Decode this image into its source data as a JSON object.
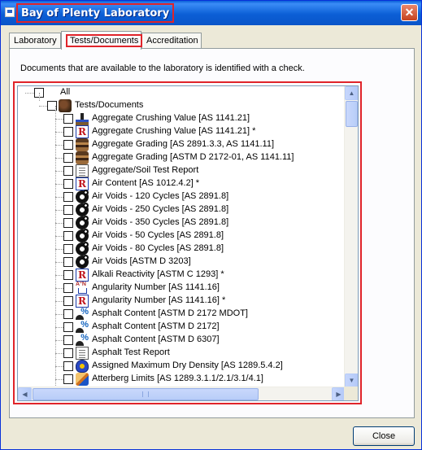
{
  "window": {
    "title": "Bay of Plenty Laboratory",
    "close_glyph": "✕"
  },
  "tabs": [
    {
      "label": "Laboratory",
      "active": false
    },
    {
      "label": "Tests/Documents",
      "active": true
    },
    {
      "label": "Accreditation",
      "active": false
    }
  ],
  "instruction": "Documents that are available to the laboratory is identified with a check.",
  "tree": {
    "root": {
      "label": "All",
      "checked": false
    },
    "group": {
      "label": "Tests/Documents",
      "checked": false,
      "icon": "folder-icon"
    },
    "items": [
      {
        "label": "Aggregate Crushing Value [AS 1141.21]",
        "icon": "crush",
        "checked": false
      },
      {
        "label": "Aggregate Crushing Value [AS 1141.21] *",
        "icon": "r",
        "checked": false
      },
      {
        "label": "Aggregate Grading [AS 2891.3.3, AS 1141.11]",
        "icon": "stack",
        "checked": false
      },
      {
        "label": "Aggregate Grading [ASTM D 2172-01, AS 1141.11]",
        "icon": "stack",
        "checked": false
      },
      {
        "label": "Aggregate/Soil Test Report",
        "icon": "doc",
        "checked": false
      },
      {
        "label": "Air Content [AS 1012.4.2] *",
        "icon": "r",
        "checked": false
      },
      {
        "label": "Air Voids - 120 Cycles [AS 2891.8]",
        "icon": "gear",
        "checked": false
      },
      {
        "label": "Air Voids - 250 Cycles [AS 2891.8]",
        "icon": "gear",
        "checked": false
      },
      {
        "label": "Air Voids - 350 Cycles [AS 2891.8]",
        "icon": "gear",
        "checked": false
      },
      {
        "label": "Air Voids - 50 Cycles [AS 2891.8]",
        "icon": "gear",
        "checked": false
      },
      {
        "label": "Air Voids - 80 Cycles [AS 2891.8]",
        "icon": "gear",
        "checked": false
      },
      {
        "label": "Air Voids [ASTM D 3203]",
        "icon": "gear",
        "checked": false
      },
      {
        "label": "Alkali Reactivity [ASTM C 1293] *",
        "icon": "r",
        "checked": false
      },
      {
        "label": "Angularity Number [AS 1141.16]",
        "icon": "ang",
        "checked": false
      },
      {
        "label": "Angularity Number [AS 1141.16] *",
        "icon": "r",
        "checked": false
      },
      {
        "label": "Asphalt Content [ASTM D 2172 MDOT]",
        "icon": "pct",
        "checked": false
      },
      {
        "label": "Asphalt Content [ASTM D 2172]",
        "icon": "pct",
        "checked": false
      },
      {
        "label": "Asphalt Content [ASTM D 6307]",
        "icon": "pct",
        "checked": false
      },
      {
        "label": "Asphalt Test Report",
        "icon": "doc",
        "checked": false
      },
      {
        "label": "Assigned Maximum Dry Density [AS 1289.5.4.2]",
        "icon": "drop",
        "checked": false
      },
      {
        "label": "Atterberg Limits [AS 1289.3.1.1/2.1/3.1/4.1]",
        "icon": "hand",
        "checked": false
      }
    ]
  },
  "scroll": {
    "up": "▲",
    "down": "▼",
    "left": "◀",
    "right": "▶"
  },
  "buttons": {
    "close": "Close"
  }
}
